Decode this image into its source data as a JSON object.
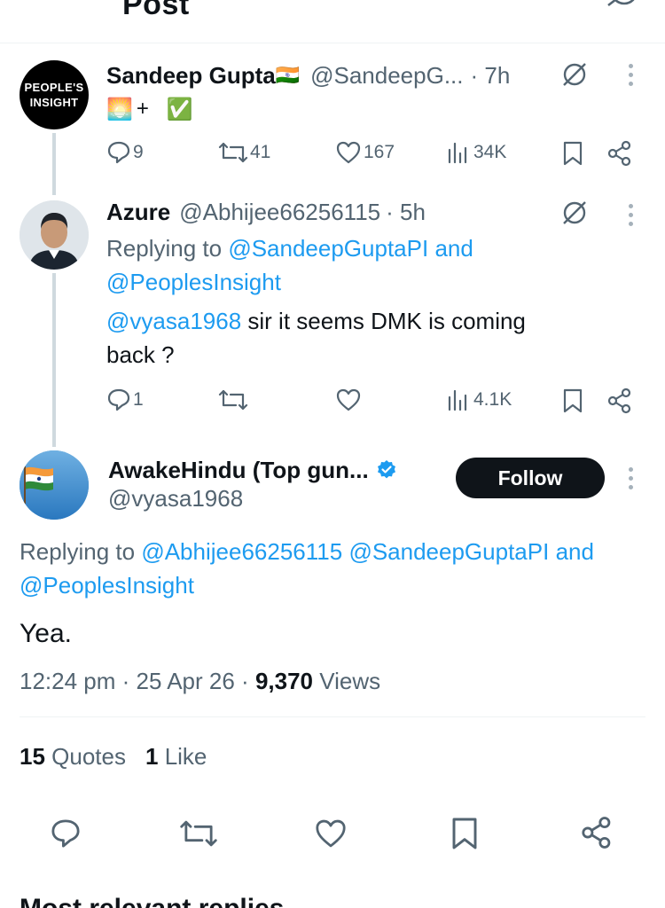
{
  "header": {
    "title": "Post"
  },
  "tweet1": {
    "avatar_line1": "PEOPLE'S",
    "avatar_line2": "INSIGHT",
    "name": "Sandeep Gupta",
    "name_emoji": "🇮🇳",
    "handle": "@SandeepG...",
    "time": "· 7h",
    "bio_emoji1": "🌅",
    "bio_plus": "+",
    "bio_emoji2": "✅",
    "replies": "9",
    "reposts": "41",
    "likes": "167",
    "views": "34K"
  },
  "tweet2": {
    "name": "Azure",
    "handle": "@Abhijee66256115",
    "time": "· 5h",
    "replying_prefix": "Replying to",
    "replying_to_1": "@SandeepGuptaPI",
    "replying_and": "and",
    "replying_to_2": "@PeoplesInsight",
    "mention": "@vyasa1968",
    "text_line1": "sir it seems DMK is coming",
    "text_line2": "back ?",
    "replies": "1",
    "reposts": "",
    "likes": "",
    "views": "4.1K"
  },
  "main_tweet": {
    "name": "AwakeHindu (Top gun...",
    "handle": "@vyasa1968",
    "follow_label": "Follow",
    "replying_prefix": "Replying to",
    "replying_to_1": "@Abhijee66256115",
    "replying_to_2": "@SandeepGuptaPI",
    "replying_and": "and",
    "replying_to_3": "@PeoplesInsight",
    "text": "Yea.",
    "timestamp": "12:24 pm · 25 Apr 26 ·",
    "views_count": "9,370",
    "views_label": "Views",
    "quotes_count": "15",
    "quotes_label": "Quotes",
    "likes_count": "1",
    "likes_label": "Like"
  },
  "footer": {
    "partial_text": "Most relevant replies"
  },
  "colors": {
    "accent": "#1d9bf0",
    "text": "#0f1419",
    "muted": "#536471",
    "button": "#0f1419",
    "verified": "#1d9bf0"
  },
  "icons": [
    "back-arrow-icon",
    "grok-icon",
    "more-icon",
    "reply-icon",
    "repost-icon",
    "like-icon",
    "views-icon",
    "bookmark-icon",
    "share-icon",
    "verified-badge-icon"
  ]
}
